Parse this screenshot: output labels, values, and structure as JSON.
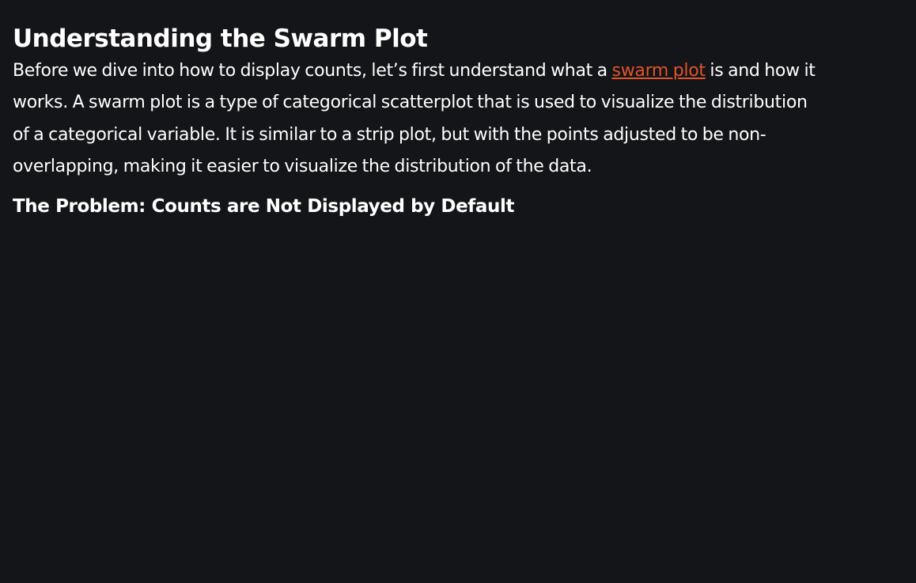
{
  "heading": "Understanding the Swarm Plot",
  "paragraph": {
    "before_link": "Before we dive into how to display counts, let’s first understand what a ",
    "link_text": "swarm plot",
    "after_link": " is and how it works. A swarm plot is a type of categorical scatterplot that is used to visualize the distribution of a categorical variable. It is similar to a strip plot, but with the points adjusted to be non-overlapping, making it easier to visualize the distribution of the data."
  },
  "subheading": "The Problem: Counts are Not Displayed by Default",
  "colors": {
    "background": "#141518",
    "link": "#e0532a"
  }
}
